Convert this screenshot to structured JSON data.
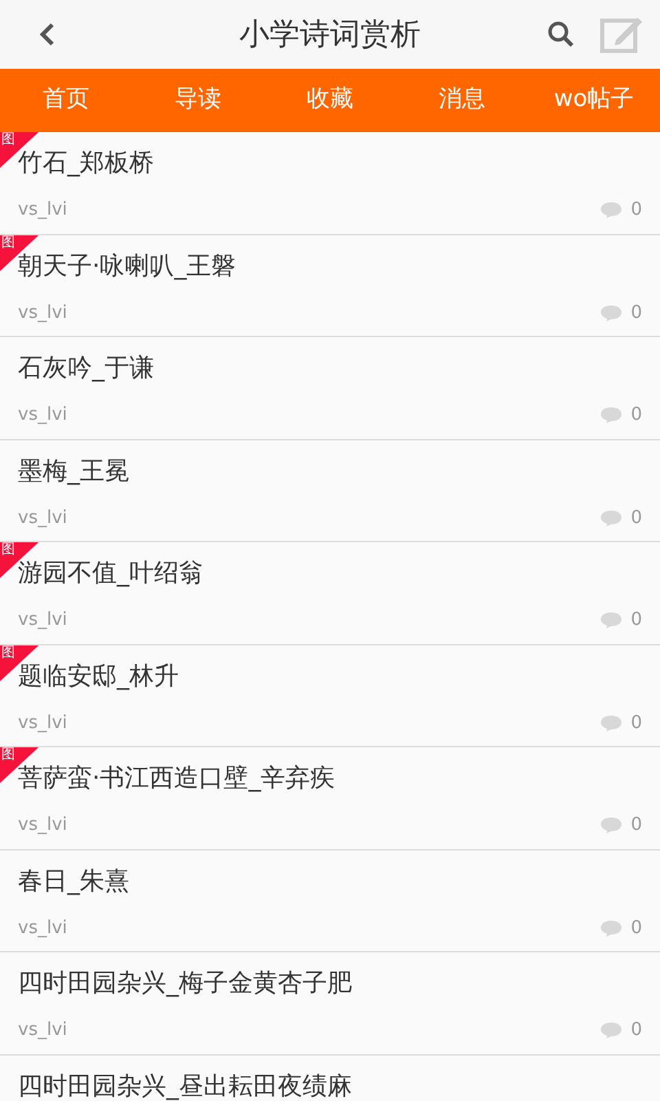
{
  "header": {
    "title": "小学诗词赏析"
  },
  "tabs": [
    {
      "label": "首页"
    },
    {
      "label": "导读"
    },
    {
      "label": "收藏"
    },
    {
      "label": "消息"
    },
    {
      "label": "wo帖子"
    }
  ],
  "posts": [
    {
      "badge": "图",
      "title": "竹石_郑板桥",
      "author": "vs_lvi",
      "comments": "0"
    },
    {
      "badge": "图",
      "title": "朝天子·咏喇叭_王磐",
      "author": "vs_lvi",
      "comments": "0"
    },
    {
      "title": "石灰吟_于谦",
      "author": "vs_lvi",
      "comments": "0"
    },
    {
      "title": "墨梅_王冕",
      "author": "vs_lvi",
      "comments": "0"
    },
    {
      "badge": "图",
      "title": "游园不值_叶绍翁",
      "author": "vs_lvi",
      "comments": "0"
    },
    {
      "badge": "图",
      "title": "题临安邸_林升",
      "author": "vs_lvi",
      "comments": "0"
    },
    {
      "badge": "图",
      "title": "菩萨蛮·书江西造口壁_辛弃疾",
      "author": "vs_lvi",
      "comments": "0"
    },
    {
      "title": "春日_朱熹",
      "author": "vs_lvi",
      "comments": "0"
    },
    {
      "title": "四时田园杂兴_梅子金黄杏子肥",
      "author": "vs_lvi",
      "comments": "0"
    },
    {
      "title": "四时田园杂兴_昼出耘田夜绩麻"
    }
  ]
}
